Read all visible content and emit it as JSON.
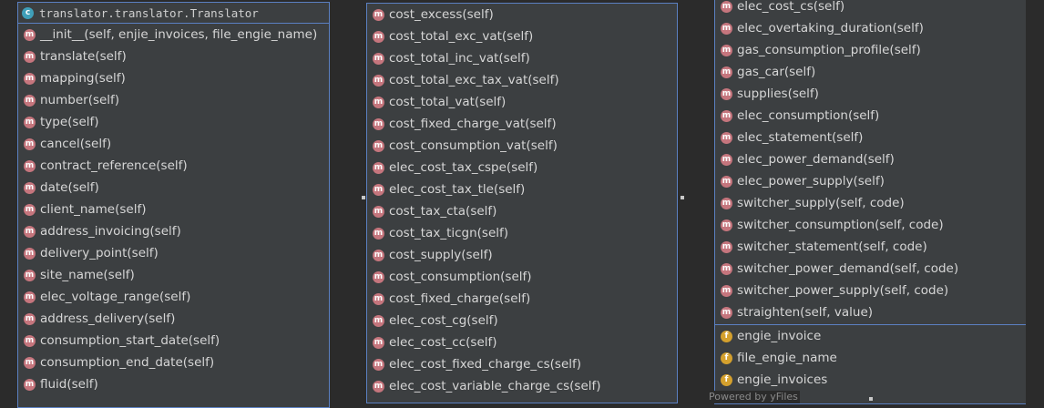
{
  "panel1": {
    "title": "translator.translator.Translator",
    "methods": [
      "__init__(self, enjie_invoices, file_engie_name)",
      "translate(self)",
      "mapping(self)",
      "number(self)",
      "type(self)",
      "cancel(self)",
      "contract_reference(self)",
      "date(self)",
      "client_name(self)",
      "address_invoicing(self)",
      "delivery_point(self)",
      "site_name(self)",
      "elec_voltage_range(self)",
      "address_delivery(self)",
      "consumption_start_date(self)",
      "consumption_end_date(self)",
      "fluid(self)"
    ]
  },
  "panel2": {
    "methods": [
      "cost_excess(self)",
      "cost_total_exc_vat(self)",
      "cost_total_inc_vat(self)",
      "cost_total_exc_tax_vat(self)",
      "cost_total_vat(self)",
      "cost_fixed_charge_vat(self)",
      "cost_consumption_vat(self)",
      "elec_cost_tax_cspe(self)",
      "elec_cost_tax_tle(self)",
      "cost_tax_cta(self)",
      "cost_tax_ticgn(self)",
      "cost_supply(self)",
      "cost_consumption(self)",
      "cost_fixed_charge(self)",
      "elec_cost_cg(self)",
      "elec_cost_cc(self)",
      "elec_cost_fixed_charge_cs(self)",
      "elec_cost_variable_charge_cs(self)"
    ]
  },
  "panel3": {
    "methods": [
      "elec_cost_cs(self)",
      "elec_overtaking_duration(self)",
      "gas_consumption_profile(self)",
      "gas_car(self)",
      "supplies(self)",
      "elec_consumption(self)",
      "elec_statement(self)",
      "elec_power_demand(self)",
      "elec_power_supply(self)",
      "switcher_supply(self, code)",
      "switcher_consumption(self, code)",
      "switcher_statement(self, code)",
      "switcher_power_demand(self, code)",
      "switcher_power_supply(self, code)",
      "straighten(self, value)"
    ],
    "fields": [
      "engie_invoice",
      "file_engie_name",
      "engie_invoices"
    ]
  },
  "icons": {
    "class_letter": "c",
    "method_letter": "m",
    "field_letter": "f"
  },
  "credit": "Powered by yFiles",
  "colors": {
    "background": "#2b2b2b",
    "panel": "#3c3f41",
    "border": "#5b80c2",
    "method_icon": "#c5757d",
    "field_icon": "#d4a02d",
    "class_icon": "#3f9fb9"
  }
}
